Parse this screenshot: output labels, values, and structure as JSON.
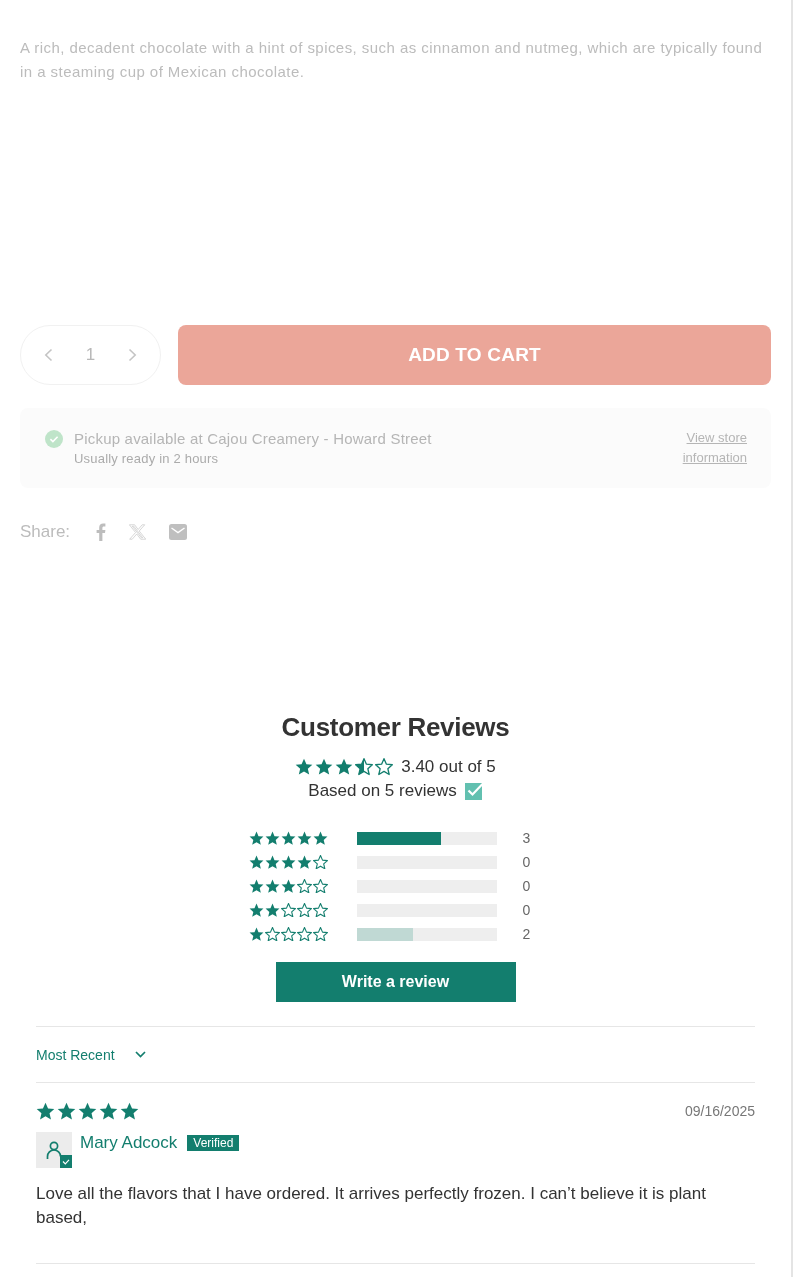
{
  "product": {
    "description": "A rich, decadent chocolate with a hint of spices, such as cinnamon and nutmeg, which are typically found in a steaming cup of Mexican chocolate.",
    "quantity": {
      "value": "1"
    },
    "add_to_cart": {
      "label": "ADD TO CART"
    },
    "pickup": {
      "title": "Pickup available at Cajou Creamery - Howard Street",
      "note": "Usually ready in 2 hours",
      "link": "View store information"
    },
    "share": {
      "label": "Share:"
    }
  },
  "reviews": {
    "title": "Customer Reviews",
    "average": {
      "stars": 3.4,
      "text": "3.40 out of 5"
    },
    "summary": "Based on 5 reviews",
    "histogram": [
      {
        "stars": 5,
        "level": 0.6,
        "count": "3",
        "color": "#137e6e"
      },
      {
        "stars": 4,
        "level": 0,
        "count": "0"
      },
      {
        "stars": 3,
        "level": 0,
        "count": "0"
      },
      {
        "stars": 2,
        "level": 0,
        "count": "0"
      },
      {
        "stars": 1,
        "level": 0.4,
        "count": "2",
        "color": "#c0d9d4"
      }
    ],
    "write_button": {
      "label": "Write a review"
    },
    "sort": {
      "value": "Most Recent"
    },
    "items": [
      {
        "stars": 5,
        "date": "09/16/2025",
        "author": "Mary Adcock",
        "badge": "Verified",
        "body": "Love all the flavors that I have ordered. It arrives perfectly frozen. I can’t believe it is plant based,"
      }
    ]
  }
}
